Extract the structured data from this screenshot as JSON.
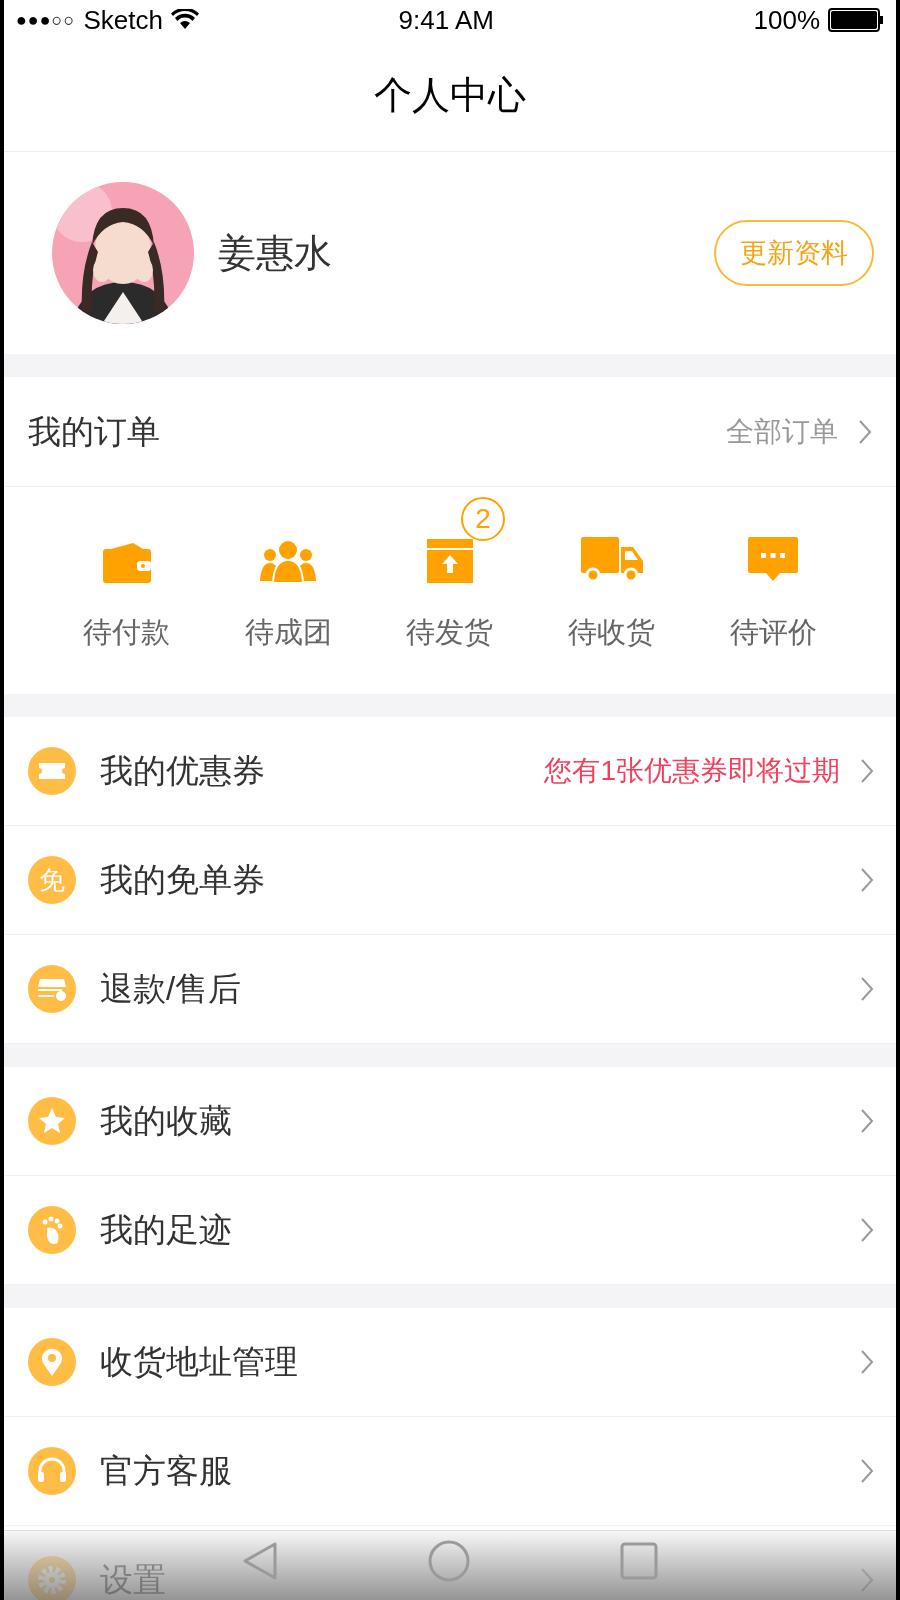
{
  "status_bar": {
    "signal": "●●●○○",
    "carrier": "Sketch",
    "time": "9:41 AM",
    "battery": "100%"
  },
  "nav": {
    "title": "个人中心"
  },
  "profile": {
    "name": "姜惠水",
    "button": "更新资料"
  },
  "orders": {
    "title": "我的订单",
    "link": "全部订单",
    "items": [
      {
        "label": "待付款"
      },
      {
        "label": "待成团"
      },
      {
        "label": "待发货",
        "badge": "2"
      },
      {
        "label": "待收货"
      },
      {
        "label": "待评价"
      }
    ]
  },
  "menu_groups": [
    {
      "items": [
        {
          "label": "我的优惠券",
          "note": "您有1张优惠券即将过期"
        },
        {
          "label": "我的免单券",
          "icon_text": "免"
        },
        {
          "label": "退款/售后"
        }
      ]
    },
    {
      "items": [
        {
          "label": "我的收藏"
        },
        {
          "label": "我的足迹"
        }
      ]
    },
    {
      "items": [
        {
          "label": "收货地址管理"
        },
        {
          "label": "官方客服"
        },
        {
          "label": "设置"
        }
      ]
    }
  ]
}
